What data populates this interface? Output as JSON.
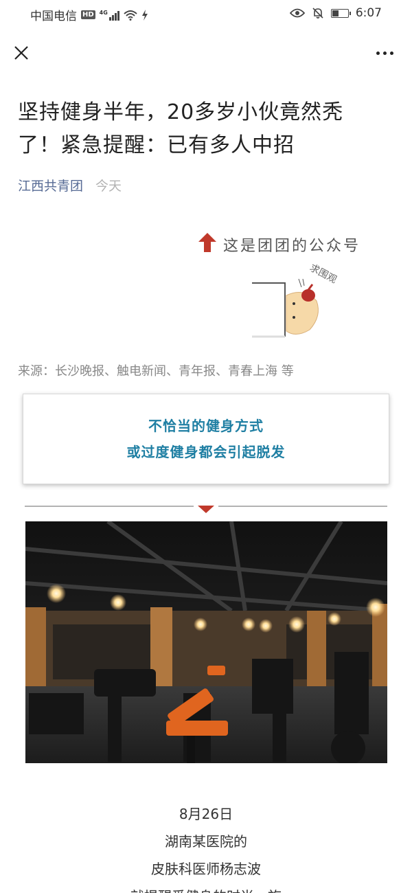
{
  "status_bar": {
    "carrier": "中国电信",
    "hd_badge": "HD",
    "network": "4G",
    "time": "6:07",
    "icons": [
      "eye-icon",
      "bell-off-icon",
      "battery-icon"
    ]
  },
  "nav": {
    "close_icon": "close-icon",
    "more_icon": "more-icon"
  },
  "article": {
    "title_line1": "坚持健身半年，20多岁小伙竟然秃",
    "title_line2": "了！紧急提醒：已有多人中招",
    "author": "江西共青团",
    "date": "今天"
  },
  "promo": {
    "text": "这是团团的公众号",
    "sub": "求围观"
  },
  "source": "来源：长沙晚报、触电新闻、青年报、青春上海 等",
  "highlight": {
    "line1": "不恰当的健身方式",
    "line2": "或过度健身都会引起脱发"
  },
  "body": {
    "line1": "8月26日",
    "line2": "湖南某医院的",
    "line3": "皮肤科医师杨志波",
    "line4": "就提醒爱健身的时尚一族"
  },
  "colors": {
    "author_link": "#576b95",
    "highlight_text": "#1f7fa3",
    "accent_red": "#c0392b"
  }
}
